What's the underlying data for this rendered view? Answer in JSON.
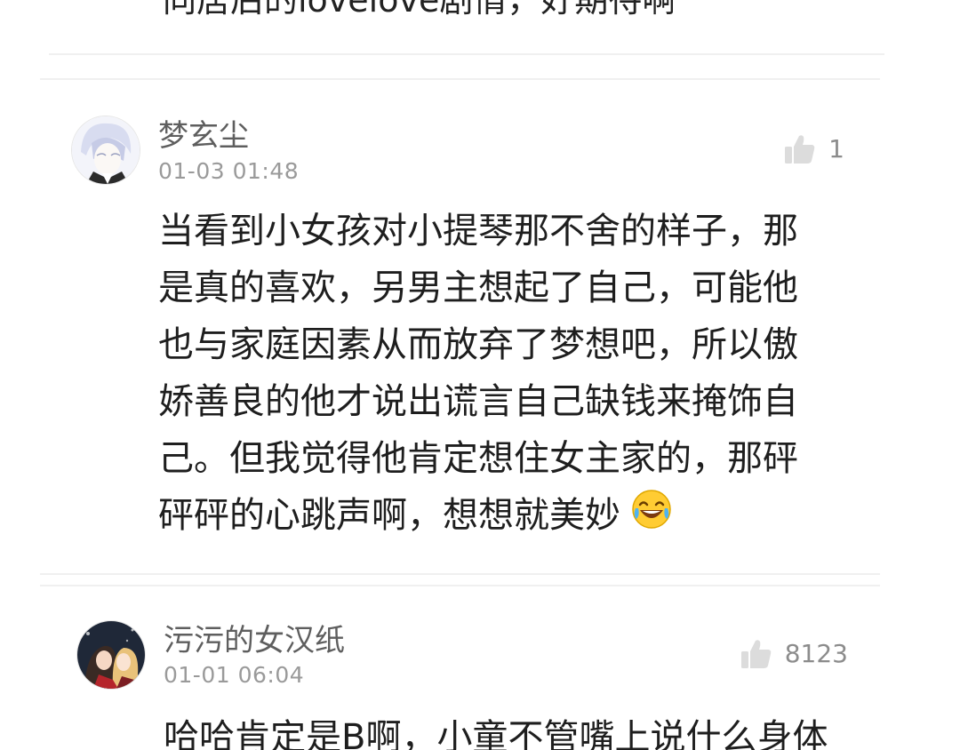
{
  "top_partial_text": "同居后的lovelove剧情，好期待啊",
  "comments": [
    {
      "username": "梦玄尘",
      "timestamp": "01-03 01:48",
      "likes": "1",
      "avatar_icon": "anime-white-hair-boy-avatar",
      "lines": [
        "当看到小女孩对小提琴那不舍的样子，那",
        "是真的喜欢，另男主想起了自己，可能他",
        "也与家庭因素从而放弃了梦想吧，所以傲",
        "娇善良的他才说出谎言自己缺钱来掩饰自",
        "己。但我觉得他肯定想住女主家的，那砰",
        "砰砰的心跳声啊，想想就美妙"
      ],
      "emoji": "😂"
    },
    {
      "username": "污污的女汉纸",
      "timestamp": "01-01 06:04",
      "likes": "8123",
      "avatar_icon": "anime-couple-avatar",
      "lines": [
        "哈哈肯定是B啊，小童不管嘴上说什么身体"
      ]
    }
  ],
  "colors": {
    "username": "#5e5e5e",
    "timestamp": "#9a9a9a",
    "body_text": "#1e1e1e",
    "divider": "#f0f0f0",
    "like_icon": "#dcdcdc"
  }
}
